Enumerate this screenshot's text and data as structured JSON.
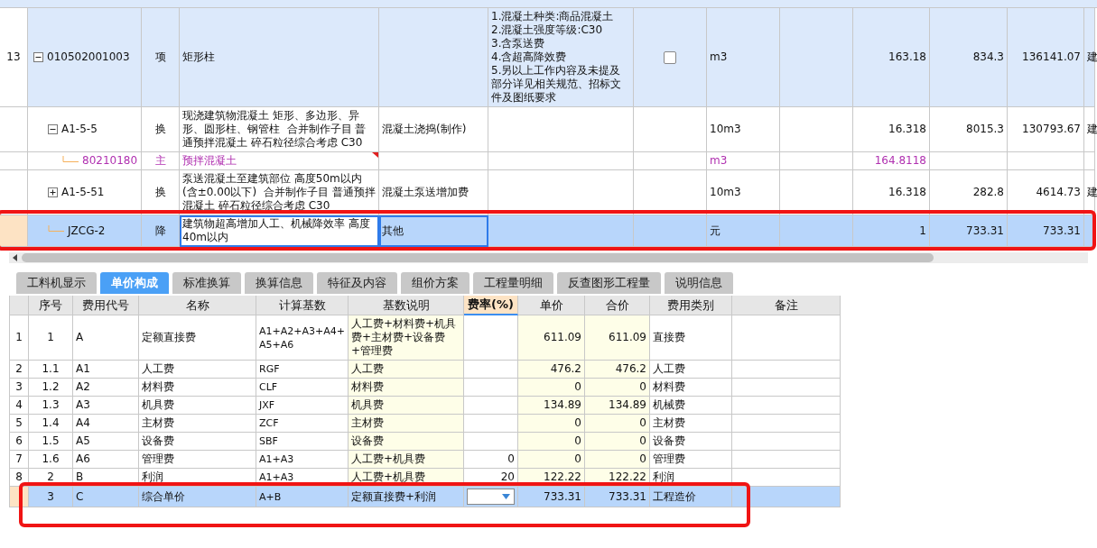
{
  "top_table": {
    "rows": [
      {
        "column_1": "13",
        "column_2": "010502001003",
        "column_3": "项",
        "column_4": "矩形柱",
        "column_6": [
          "1.混凝土种类:商品混凝土",
          "2.混凝土强度等级:C30",
          "3.含泵送费",
          "4.含超高降效费",
          "5.另以上工作内容及未提及部分详见相关规范、招标文件及图纸要求"
        ],
        "checked": false,
        "column_8": "m3",
        "column_10": "163.18",
        "column_11": "834.3",
        "column_12": "136141.07",
        "column_13": "建",
        "kind": "item",
        "selected": false,
        "expanded": true,
        "children": [
          {
            "column_2": "A1-5-5",
            "column_3": "换",
            "column_4": "现浇建筑物混凝土 矩形、多边形、异形、圆形柱、钢管柱  合并制作子目 普通预拌混凝土 碎石粒径综合考虑 C30",
            "column_5": "混凝土浇捣(制作)",
            "column_8": "10m3",
            "column_10": "16.318",
            "column_11": "8015.3",
            "column_12": "130793.67",
            "column_13": "建",
            "kind": "quota",
            "selected": false,
            "expanded": true,
            "children": [
              {
                "column_2": "80210180",
                "column_3": "主",
                "column_4": "预拌混凝土",
                "note_mark": true,
                "column_8": "m3",
                "column_10": "164.8118",
                "kind": "main_material",
                "selected": false
              }
            ]
          },
          {
            "column_2": "A1-5-51",
            "column_3": "换",
            "column_4": "泵送混凝土至建筑部位 高度50m以内(含±0.00以下)  合并制作子目 普通预拌混凝土 碎石粒径综合考虑 C30",
            "column_5": "混凝土泵送增加费",
            "column_8": "10m3",
            "column_10": "16.318",
            "column_11": "282.8",
            "column_12": "4614.73",
            "column_13": "建",
            "kind": "quota",
            "selected": false,
            "expanded": false
          },
          {
            "column_2": "JZCG-2",
            "column_3": "降",
            "column_4": "建筑物超高增加人工、机械降效率 高度40m以内",
            "column_5": "其他",
            "column_8": "元",
            "column_10": "1",
            "column_11": "733.31",
            "column_12": "733.31",
            "kind": "quota",
            "selected": true,
            "highlighted": true
          }
        ]
      }
    ]
  },
  "tabs": [
    {
      "label": "工料机显示",
      "selected": false
    },
    {
      "label": "单价构成",
      "selected": true
    },
    {
      "label": "标准换算",
      "selected": false
    },
    {
      "label": "换算信息",
      "selected": false
    },
    {
      "label": "特征及内容",
      "selected": false
    },
    {
      "label": "组价方案",
      "selected": false
    },
    {
      "label": "工程量明细",
      "selected": false
    },
    {
      "label": "反查图形工程量",
      "selected": false
    },
    {
      "label": "说明信息",
      "selected": false
    }
  ],
  "price_table": {
    "columns": [
      {
        "selected": false,
        "shaded": false
      },
      {
        "label": "序号",
        "selected": false,
        "shaded": false
      },
      {
        "label": "费用代号",
        "selected": false,
        "shaded": false
      },
      {
        "label": "名称",
        "selected": false,
        "shaded": false
      },
      {
        "label": "计算基数",
        "selected": false,
        "shaded": false
      },
      {
        "label": "基数说明",
        "selected": false,
        "shaded": true
      },
      {
        "label": "费率(%)",
        "selected": true,
        "shaded": false
      },
      {
        "label": "单价",
        "selected": false,
        "shaded": true
      },
      {
        "label": "合价",
        "selected": false,
        "shaded": true
      },
      {
        "label": "费用类别",
        "selected": false,
        "shaded": false
      },
      {
        "label": "备注",
        "selected": false,
        "shaded": false
      }
    ],
    "rows": [
      {
        "row_number": "1",
        "seq": "1",
        "code": "A",
        "name": "定额直接费",
        "base": "A1+A2+A3+A4+A5+A6",
        "base_desc": "人工费+材料费+机具费+主材费+设备费+管理费",
        "unit_price": "611.09",
        "total": "611.09",
        "category": "直接费",
        "selected": false,
        "highlighted": false
      },
      {
        "row_number": "2",
        "seq": "1.1",
        "code": "A1",
        "name": "人工费",
        "base": "RGF",
        "base_desc": "人工费",
        "unit_price": "476.2",
        "total": "476.2",
        "category": "人工费",
        "selected": false,
        "highlighted": false
      },
      {
        "row_number": "3",
        "seq": "1.2",
        "code": "A2",
        "name": "材料费",
        "base": "CLF",
        "base_desc": "材料费",
        "unit_price": "0",
        "total": "0",
        "category": "材料费",
        "selected": false,
        "highlighted": false
      },
      {
        "row_number": "4",
        "seq": "1.3",
        "code": "A3",
        "name": "机具费",
        "base": "JXF",
        "base_desc": "机具费",
        "unit_price": "134.89",
        "total": "134.89",
        "category": "机械费",
        "selected": false,
        "highlighted": false
      },
      {
        "row_number": "5",
        "seq": "1.4",
        "code": "A4",
        "name": "主材费",
        "base": "ZCF",
        "base_desc": "主材费",
        "unit_price": "0",
        "total": "0",
        "category": "主材费",
        "selected": false,
        "highlighted": false
      },
      {
        "row_number": "6",
        "seq": "1.5",
        "code": "A5",
        "name": "设备费",
        "base": "SBF",
        "base_desc": "设备费",
        "unit_price": "0",
        "total": "0",
        "category": "设备费",
        "selected": false,
        "highlighted": false
      },
      {
        "row_number": "7",
        "seq": "1.6",
        "code": "A6",
        "name": "管理费",
        "base": "A1+A3",
        "base_desc": "人工费+机具费",
        "rate": "0",
        "unit_price": "0",
        "total": "0",
        "category": "管理费",
        "selected": false,
        "highlighted": false
      },
      {
        "row_number": "8",
        "seq": "2",
        "code": "B",
        "name": "利润",
        "base": "A1+A3",
        "base_desc": "人工费+机具费",
        "rate": "20",
        "unit_price": "122.22",
        "total": "122.22",
        "category": "利润",
        "selected": false,
        "highlighted": false
      },
      {
        "seq": "3",
        "code": "C",
        "name": "综合单价",
        "base": "A+B",
        "base_desc": "定额直接费+利润",
        "unit_price": "733.31",
        "total": "733.31",
        "category": "工程造价",
        "selected": true,
        "highlighted": true
      }
    ]
  }
}
